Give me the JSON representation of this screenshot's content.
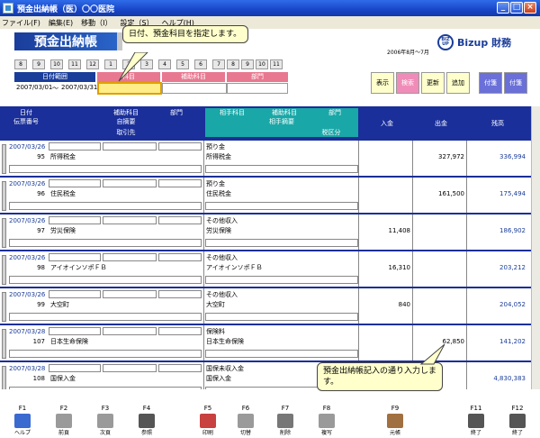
{
  "window": {
    "title": "預金出納帳（医）〇〇医院"
  },
  "menu": [
    "ファイル(F)",
    "編集(E)",
    "移動（I）",
    "設定（S）",
    "ヘルプ(H)"
  ],
  "page": {
    "title": "預金出納帳",
    "period": "2006年8月～7月",
    "logo_text": "Bizup 財務",
    "logo_badge": "BIZ UP"
  },
  "month_buttons_a": [
    "8",
    "9",
    "10",
    "11",
    "12",
    "1",
    "2",
    "3",
    "4",
    "5",
    "6",
    "7"
  ],
  "month_buttons_b": [
    "8",
    "9",
    "10",
    "11"
  ],
  "filter": {
    "date_range_label": "日付範囲",
    "account_label": "科目",
    "sub_account_label": "補助科目",
    "dept_label": "部門",
    "date_from": "2007/03/01",
    "tilde": "～",
    "date_to": "2007/03/31"
  },
  "actions": [
    "表示",
    "検索",
    "更新",
    "追加",
    "付箋",
    "付箋"
  ],
  "table_header": {
    "date": "日付",
    "voucher": "伝票番号",
    "sub_account": "補助科目",
    "dept": "部門",
    "own_summary": "自摘要",
    "counterparty": "取引先",
    "counter_account": "相手科目",
    "counter_sub": "補助科目",
    "counter_dept": "部門",
    "counter_summary": "相手摘要",
    "tax": "税区分",
    "deposit": "入金",
    "withdrawal": "出金",
    "balance": "残高"
  },
  "rows": [
    {
      "date": "2007/03/26",
      "no": "95",
      "own": "所得税金",
      "acct": "預り金",
      "acct_sum": "所得税金",
      "in": "",
      "out": "327,972",
      "bal": "336,994"
    },
    {
      "date": "2007/03/26",
      "no": "96",
      "own": "住民税金",
      "acct": "預り金",
      "acct_sum": "住民税金",
      "in": "",
      "out": "161,500",
      "bal": "175,494"
    },
    {
      "date": "2007/03/26",
      "no": "97",
      "own": "労災保険",
      "acct": "その他収入",
      "acct_sum": "労災保険",
      "in": "11,408",
      "out": "",
      "bal": "186,902"
    },
    {
      "date": "2007/03/26",
      "no": "98",
      "own": "アイオインソポＦＢ",
      "acct": "その他収入",
      "acct_sum": "アイオインソポＦＢ",
      "in": "16,310",
      "out": "",
      "bal": "203,212"
    },
    {
      "date": "2007/03/26",
      "no": "99",
      "own": "大空町",
      "acct": "その他収入",
      "acct_sum": "大空町",
      "in": "840",
      "out": "",
      "bal": "204,052"
    },
    {
      "date": "2007/03/28",
      "no": "107",
      "own": "日本生命保険",
      "acct": "保険料",
      "acct_sum": "日本生命保険",
      "in": "",
      "out": "62,850",
      "bal": "141,202"
    },
    {
      "date": "2007/03/28",
      "no": "108",
      "own": "国保入金",
      "acct": "国保未収入金",
      "acct_sum": "国保入金",
      "in": "",
      "out": "",
      "bal": "4,830,383"
    }
  ],
  "fkeys": [
    {
      "key": "F1",
      "label": "ヘルプ"
    },
    {
      "key": "F2",
      "label": "前頁"
    },
    {
      "key": "F3",
      "label": "次頁"
    },
    {
      "key": "F4",
      "label": "参照"
    },
    {
      "key": "F5",
      "label": "印刷"
    },
    {
      "key": "F6",
      "label": "切替"
    },
    {
      "key": "F7",
      "label": "削除"
    },
    {
      "key": "F8",
      "label": "複写"
    },
    {
      "key": "F9",
      "label": "元帳"
    },
    {
      "key": "F11",
      "label": "終了"
    },
    {
      "key": "F12",
      "label": "終了"
    }
  ],
  "callouts": {
    "top": "日付、預金科目を指定します。",
    "bottom": "預金出納帳記入の通り入力します。"
  },
  "colors": {
    "title_blue": "#1a3d9a",
    "header_blue": "#1a2f9a",
    "teal": "#1aa7a7",
    "pink": "#e87890",
    "callout_bg": "#ffffcc"
  }
}
